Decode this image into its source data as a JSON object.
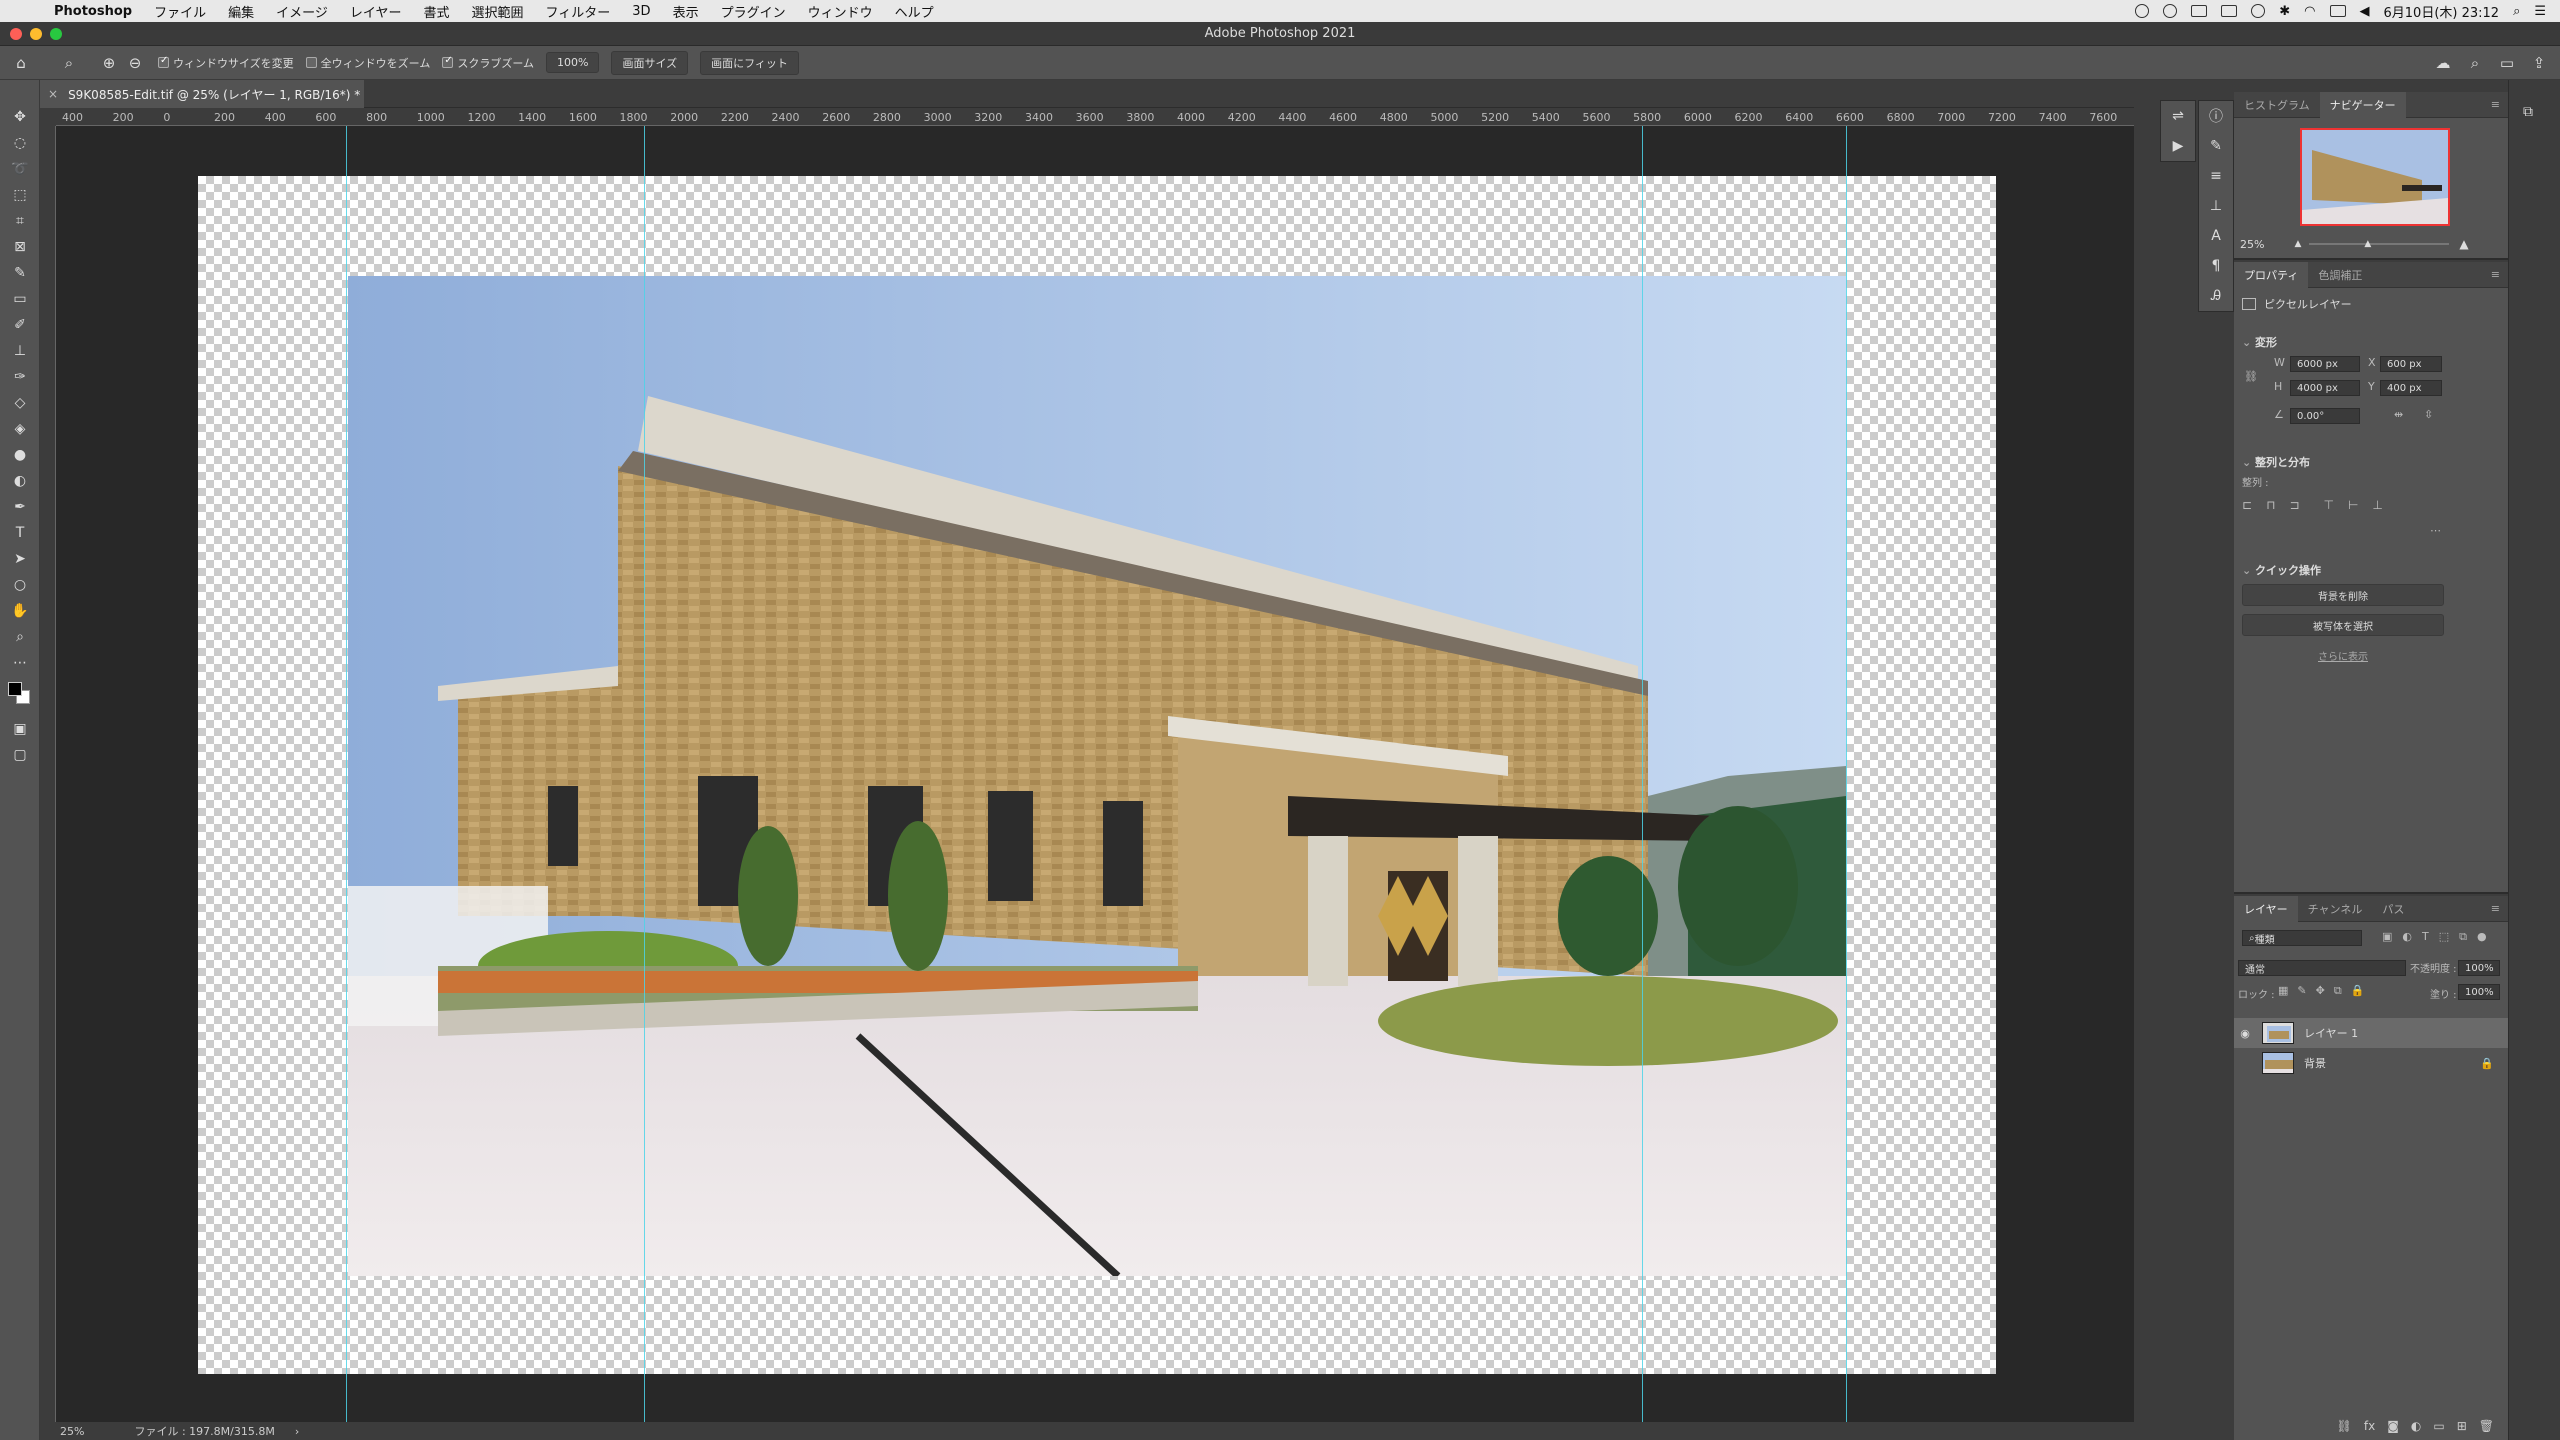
{
  "menubar": {
    "app_name": "Photoshop",
    "items": [
      "ファイル",
      "編集",
      "イメージ",
      "レイヤー",
      "書式",
      "選択範囲",
      "フィルター",
      "3D",
      "表示",
      "プラグイン",
      "ウィンドウ",
      "ヘルプ"
    ],
    "datetime": "6月10日(木)  23:12"
  },
  "window": {
    "title": "Adobe Photoshop 2021"
  },
  "options_bar": {
    "resize_windows": "ウィンドウサイズを変更",
    "zoom_all": "全ウィンドウをズーム",
    "scrubby_zoom": "スクラブズーム",
    "zoom_100": "100%",
    "fit_screen": "画面サイズ",
    "fill_screen": "画面にフィット"
  },
  "document": {
    "tab_label": "S9K08585-Edit.tif @ 25% (レイヤー 1, RGB/16*) *"
  },
  "ruler": {
    "h_labels": [
      "400",
      "200",
      "0",
      "200",
      "400",
      "600",
      "800",
      "1000",
      "1200",
      "1400",
      "1600",
      "1800",
      "2000",
      "2200",
      "2400",
      "2600",
      "2800",
      "3000",
      "3200",
      "3400",
      "3600",
      "3800",
      "4000",
      "4200",
      "4400",
      "4600",
      "4800",
      "5000",
      "5200",
      "5400",
      "5600",
      "5800",
      "6000",
      "6200",
      "6400",
      "6600",
      "6800",
      "7000",
      "7200",
      "7400",
      "7600"
    ]
  },
  "status": {
    "zoom": "25%",
    "file_info": "ファイル : 197.8M/315.8M"
  },
  "navigator": {
    "tabs": [
      "ヒストグラム",
      "ナビゲーター"
    ],
    "zoom": "25%"
  },
  "properties": {
    "tabs": [
      "プロパティ",
      "色調補正"
    ],
    "layer_type": "ピクセルレイヤー",
    "transform_label": "変形",
    "w_label": "W",
    "w_value": "6000 px",
    "x_label": "X",
    "x_value": "600 px",
    "h_label": "H",
    "h_value": "4000 px",
    "y_label": "Y",
    "y_value": "400 px",
    "angle_value": "0.00°",
    "align_label": "整列と分布",
    "align_sub": "整列 :",
    "quick_label": "クイック操作",
    "remove_bg": "背景を削除",
    "select_subject": "被写体を選択",
    "show_more": "さらに表示"
  },
  "layers": {
    "tabs": [
      "レイヤー",
      "チャンネル",
      "パス"
    ],
    "filter_kind": "種類",
    "blend_mode": "通常",
    "opacity_label": "不透明度 :",
    "opacity_value": "100%",
    "lock_label": "ロック :",
    "fill_label": "塗り :",
    "fill_value": "100%",
    "items": [
      {
        "name": "レイヤー 1",
        "selected": true,
        "visible": true
      },
      {
        "name": "背景",
        "selected": false,
        "visible": false,
        "locked": true
      }
    ]
  },
  "colors": {
    "guide": "#4cd4e8",
    "accent_red": "#e33333"
  }
}
